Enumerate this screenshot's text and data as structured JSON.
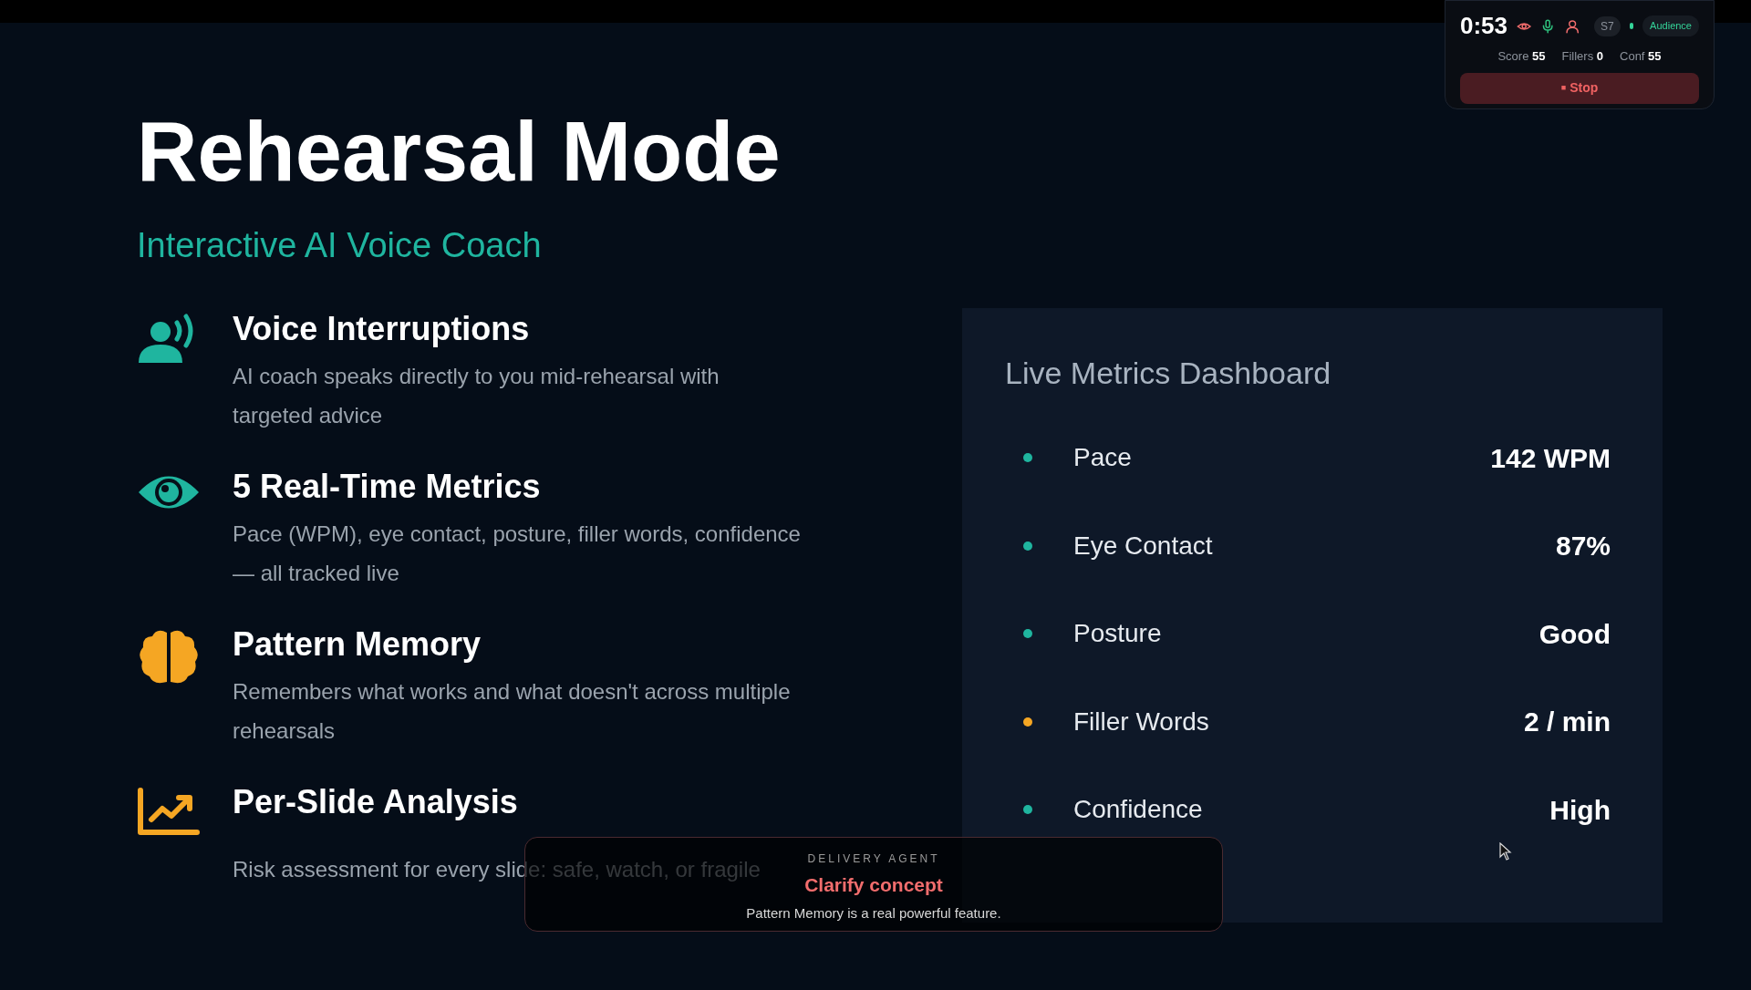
{
  "slide": {
    "title": "Rehearsal Mode",
    "subtitle": "Interactive AI Voice Coach",
    "features": [
      {
        "kind": "voice",
        "title": "Voice Interruptions",
        "description": "AI coach speaks directly to you mid-rehearsal with targeted advice"
      },
      {
        "kind": "eye",
        "title": "5 Real-Time Metrics",
        "description": "Pace (WPM), eye contact, posture, filler words, confidence — all tracked live"
      },
      {
        "kind": "brain",
        "title": "Pattern Memory",
        "description": "Remembers what works and what doesn't across multiple rehearsals"
      },
      {
        "kind": "chart",
        "title": "Per-Slide Analysis",
        "description": "Risk assessment for every slide: safe, watch, or fragile"
      }
    ],
    "dashboard": {
      "title": "Live Metrics Dashboard",
      "metrics": [
        {
          "label": "Pace",
          "value": "142 WPM",
          "color": "#1fb59f"
        },
        {
          "label": "Eye Contact",
          "value": "87%",
          "color": "#1fb59f"
        },
        {
          "label": "Posture",
          "value": "Good",
          "color": "#1fb59f"
        },
        {
          "label": "Filler Words",
          "value": "2 / min",
          "color": "#f5a623"
        },
        {
          "label": "Confidence",
          "value": "High",
          "color": "#1fb59f"
        }
      ]
    }
  },
  "hud": {
    "timer": "0:53",
    "indicators": [
      {
        "kind": "eye",
        "color": "#f26d6d"
      },
      {
        "kind": "mic",
        "color": "#2ec27e"
      },
      {
        "kind": "person",
        "color": "#f26d6d"
      }
    ],
    "slide_badge": "S7",
    "mode": {
      "label": "Audience",
      "color": "#34d399"
    },
    "stats": [
      {
        "label": "Score",
        "value": "55"
      },
      {
        "label": "Fillers",
        "value": "0"
      },
      {
        "label": "Conf",
        "value": "55"
      }
    ],
    "stop_button": {
      "icon": "■",
      "label": "Stop"
    }
  },
  "toast": {
    "agent": "DELIVERY AGENT",
    "headline": "Clarify concept",
    "message": "Pattern Memory is a real powerful feature."
  }
}
